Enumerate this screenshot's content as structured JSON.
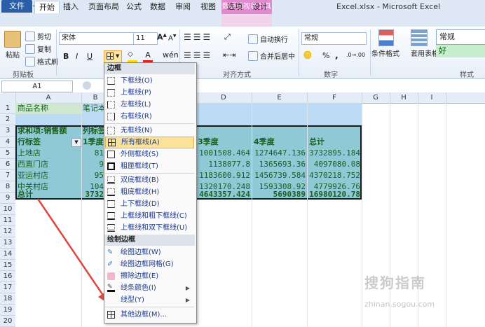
{
  "titlebar": {
    "doc_title": "Excel.xlsx - Microsoft Excel",
    "context_tab_group": "数据透视表工具"
  },
  "tabs": [
    "文件",
    "开始",
    "插入",
    "页面布局",
    "公式",
    "数据",
    "审阅",
    "视图",
    "选项",
    "设计"
  ],
  "ribbon": {
    "clipboard": {
      "paste": "粘贴",
      "cut": "剪切",
      "copy": "复制",
      "format_painter": "格式刷",
      "group_label": "剪贴板"
    },
    "font": {
      "name": "宋体",
      "size": "11",
      "bold": "B",
      "italic": "I",
      "underline": "U"
    },
    "alignment": {
      "wrap": "自动换行",
      "merge": "合并后居中",
      "group_label": "对齐方式"
    },
    "number": {
      "format": "常规",
      "percent": "%",
      "comma": ",",
      "group_label": "数字"
    },
    "styles": {
      "cond_format": "条件格式",
      "table_format": "套用表格格式",
      "normal": "常规",
      "good": "好",
      "group_label": "样式"
    }
  },
  "formula_bar": {
    "name_box": "A1"
  },
  "columns": [
    "A",
    "B",
    "C",
    "D",
    "E",
    "F",
    "G",
    "H",
    "I"
  ],
  "rows": [
    "1",
    "2",
    "3",
    "4",
    "5",
    "6",
    "7",
    "8",
    "9",
    "10",
    "11",
    "12",
    "13",
    "14",
    "15",
    "16",
    "17",
    "18",
    "19",
    "20"
  ],
  "cells": {
    "A1": "商品名称",
    "B1": "笔记本",
    "A3": "求和项:销售额",
    "B3": "列标签",
    "A4": "行标签",
    "B4": "1季度",
    "D4": "3季度",
    "E4": "4季度",
    "F4": "总计",
    "A5": "上地店",
    "B5": "81",
    "D5": "1001508.464",
    "E5": "1274647.136",
    "F5": "3732895.184",
    "A6": "西直门店",
    "B6": "9",
    "D6": "1138077.8",
    "E6": "1365693.36",
    "F6": "4097080.08",
    "A7": "亚运村店",
    "B7": "95",
    "D7": "1183600.912",
    "E7": "1456739.584",
    "F7": "4370218.752",
    "A8": "中关村店",
    "B8": "104",
    "D8": "1320170.248",
    "E8": "1593308.92",
    "F8": "4779926.76",
    "A9": "总计",
    "B9": "3732",
    "D9": "4643357.424",
    "E9": "5690389",
    "F9": "16980120.78"
  },
  "border_menu": {
    "section1": "边框",
    "items1": [
      "下框线(O)",
      "上框线(P)",
      "左框线(L)",
      "右框线(R)",
      "无框线(N)",
      "所有框线(A)",
      "外侧框线(S)",
      "粗匣框线(T)",
      "双底框线(B)",
      "粗底框线(H)",
      "上下框线(D)",
      "上框线和粗下框线(C)",
      "上框线和双下框线(U)"
    ],
    "selected": "所有框线(A)",
    "section2": "绘制边框",
    "items2": [
      "绘图边框(W)",
      "绘图边框网格(G)",
      "擦除边框(E)",
      "线条颜色(I)",
      "线型(Y)",
      "其他边框(M)..."
    ]
  },
  "watermark": {
    "text": "搜狗指南",
    "url_text": "zhinan.sogou.com"
  },
  "colors": {
    "accent": "#2a5ea8",
    "pivot_fill": "#8fc9d6",
    "header_fill": "#bcdcf5",
    "menu_highlight": "#fbe29a",
    "arrow": "#e0463e"
  }
}
